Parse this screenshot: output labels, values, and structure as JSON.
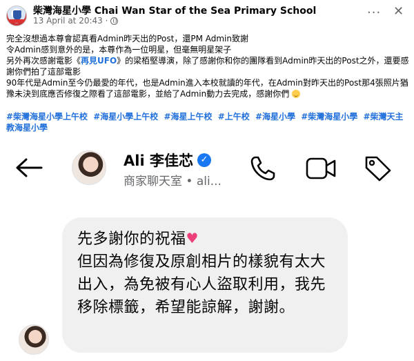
{
  "post": {
    "page_name": "柴灣海星小學 Chai Wan Star of the Sea Primary School",
    "date": "13 April at 20:43 ·",
    "line1": "完全沒想過本尊會認真看Admin昨天出的Post，還PM Admin致謝",
    "line2": "令Admin感到意外的是，本尊作為一位明星，但毫無明星架子",
    "line3_pre": "另外再次感謝電影《",
    "line3_link": "再見UFO",
    "line3_post": "》的梁栢堅導演，除了感謝你和你的團隊看到Admin昨天出的Post之外，還要感謝你們拍了這部電影",
    "line4": "90年代是Admin至今仍最愛的年代，也是Admin進入本校就讀的年代，在Admin對昨天出的Post那4張照片猶豫未決到底應否修復之際看了這部電影，並給了Admin動力去完成，感謝你們",
    "hashtags": [
      "#柴灣海星小學上午校",
      "#海星小學上午校",
      "#海星上午校",
      "#上午校",
      "#海星小學",
      "#柴灣海星小學",
      "#柴灣天主教海星小學"
    ]
  },
  "chat": {
    "contact_name": "Ali 李佳芯",
    "subtitle": "商家聊天室 • ali...",
    "message_line1": "先多謝你的祝福",
    "message_line2": "但因為修復及原創相片的樣貌有太大出入，為免被有心人盜取利用，我先移除標籤，希望能諒解，謝謝。"
  },
  "icons": {
    "back": "back-arrow-icon",
    "call": "phone-icon",
    "video": "video-camera-icon",
    "tag": "tag-icon",
    "verified": "verified-badge-icon",
    "heart": "pink-heart-icon"
  },
  "colors": {
    "link": "#216fdb",
    "meta": "#65676b",
    "bubble": "#f0f0f0",
    "verified": "#1877f2",
    "heart": "#ec407a"
  }
}
